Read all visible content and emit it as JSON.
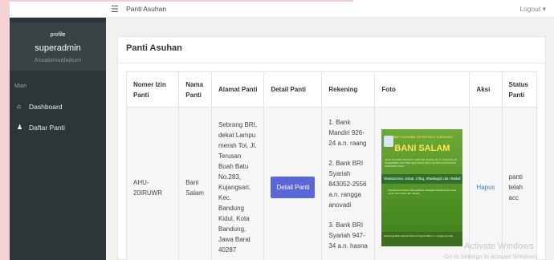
{
  "topbar": {
    "menu_icon": "hamburger-icon",
    "title": "Panti Asuhan",
    "logout_label": "Logout",
    "logout_caret": "▾"
  },
  "sidebar": {
    "profile_label": "profile",
    "username": "superadmin",
    "greeting": "Assalamualaikum",
    "nav_header": "Main",
    "items": [
      {
        "label": "Dashboard",
        "icon": "home-icon",
        "glyph": "⌂"
      },
      {
        "label": "Daftar Panti",
        "icon": "user-icon",
        "glyph": "♟"
      }
    ]
  },
  "panel": {
    "title": "Panti Asuhan"
  },
  "table": {
    "headers": [
      "Nomer Izin Panti",
      "Nama Panti",
      "Alamat Panti",
      "Detail Panti",
      "Rekening",
      "Foto",
      "Aksi",
      "Status Panti"
    ],
    "rows": [
      {
        "nomer_izin": "AHU-20IRUWR",
        "nama": "Bani Salam",
        "alamat": "Sebrang BRI, dekat Lampu merah Tol, Jl. Terusan Buah Batu No.283, Kujangsari, Kec. Bandung Kidul, Kota Bandung, Jawa Barat 40287",
        "detail_button": "Detail Panti",
        "rekening": [
          "1. Bank Mandiri 926-24 a.n. raang",
          "2. Bank BRI Syariah 843052-2556 a.n. rangga anovadi",
          "3. Bank BRI Syariah 947-34 a.n. hasna"
        ],
        "foto": {
          "header": "PANTI ASUHAN YATIM PIATU & DHUAFA",
          "name": "BANI SALAM",
          "address": "AKTE NOTARIS NOMOR 5 DOKTER SUSAN NO 12 TANGGAL 06 DESEMBER 2012 TERUSAN BUAH BATU NO 283 KUJANGSARI BANDUNG KIDUL",
          "band": "Wawancara, Zakat, Infaq, Shadaqah dan Wakaf",
          "text": "Mari Bersama Sama Menyisihkan Sebagian Rezeki Anda Untuk Anak Yatim Piatu dan Dhuafa",
          "footer": "Rekening Bank Mandiri 926-24 Syariah BRI a.n. rangga anovadi"
        },
        "aksi": "Hapus",
        "status": "panti telah acc"
      }
    ]
  },
  "watermark": {
    "line1": "Activate Windows",
    "line2": "Go to Settings to activate Windows."
  },
  "colors": {
    "sidebar": "#2d3538",
    "button": "#5b67d6",
    "link": "#3c7fc2",
    "pink_accent": "#f6d2d7"
  }
}
